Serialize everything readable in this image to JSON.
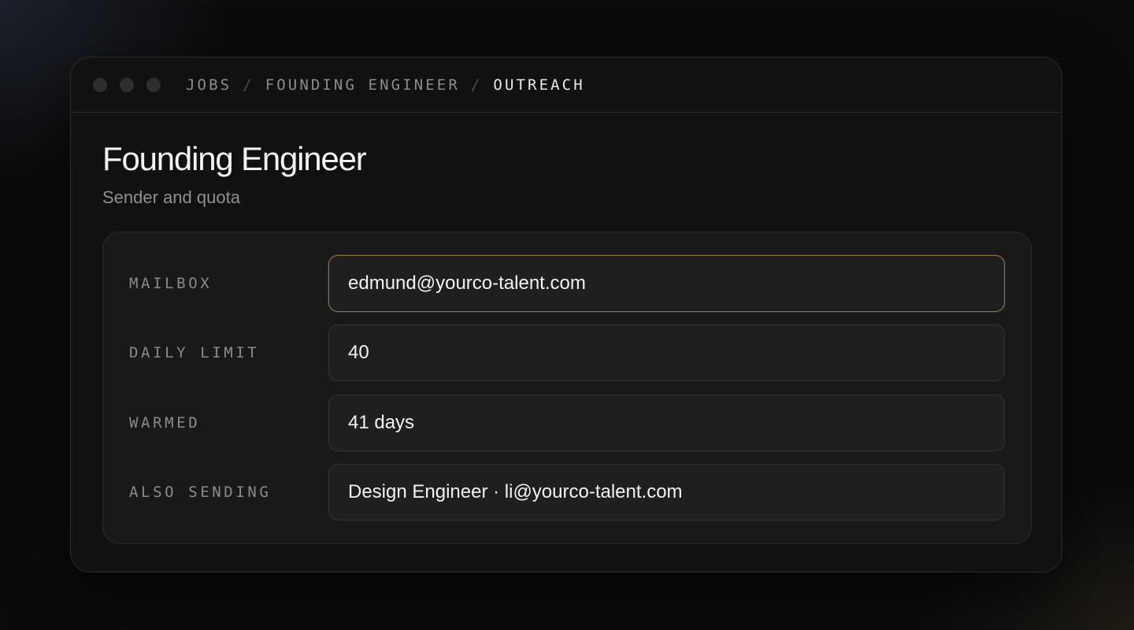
{
  "window": {
    "controls": [
      "close",
      "minimize",
      "zoom"
    ]
  },
  "breadcrumb": {
    "items": [
      {
        "label": "JOBS"
      },
      {
        "label": "FOUNDING ENGINEER"
      },
      {
        "label": "OUTREACH"
      }
    ],
    "separator": "/"
  },
  "header": {
    "title": "Founding Engineer",
    "subtitle": "Sender and quota"
  },
  "form": {
    "rows": [
      {
        "label": "MAILBOX",
        "value": "edmund@yourco-talent.com",
        "focused": true
      },
      {
        "label": "DAILY LIMIT",
        "value": "40"
      },
      {
        "label": "WARMED",
        "value": "41 days"
      },
      {
        "label": "ALSO SENDING",
        "value": "Design Engineer · li@yourco-talent.com"
      }
    ]
  },
  "colors": {
    "background": "#0b0b0c",
    "window": "#111112",
    "card": "#19191a",
    "field": "#1f1f20",
    "focus_accent": "#8a7243"
  }
}
